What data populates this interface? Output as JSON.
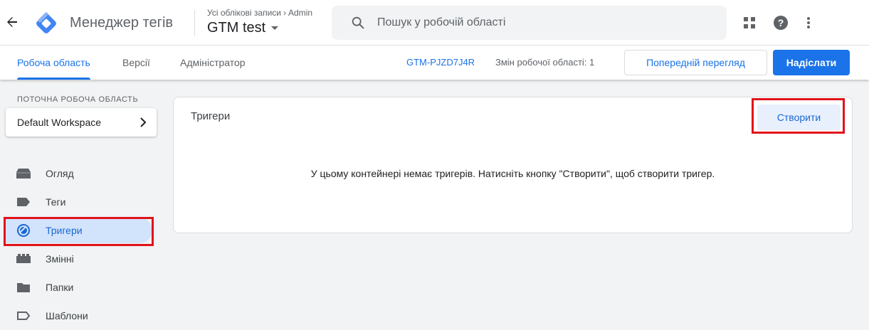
{
  "header": {
    "product_name": "Менеджер тегів",
    "breadcrumb_accounts": "Усі облікові записи",
    "breadcrumb_account": "Admin",
    "container_name": "GTM test",
    "search_placeholder": "Пошук у робочій області"
  },
  "subnav": {
    "tabs": [
      {
        "label": "Робоча область",
        "active": true
      },
      {
        "label": "Версії",
        "active": false
      },
      {
        "label": "Адміністратор",
        "active": false
      }
    ],
    "container_id": "GTM-PJZD7J4R",
    "workspace_changes": "Змін робочої області: 1",
    "preview_label": "Попередній перегляд",
    "submit_label": "Надіслати"
  },
  "sidebar": {
    "workspace_label": "ПОТОЧНА РОБОЧА ОБЛАСТЬ",
    "workspace_name": "Default Workspace",
    "items": [
      {
        "label": "Огляд",
        "icon": "overview-icon"
      },
      {
        "label": "Теги",
        "icon": "tag-icon"
      },
      {
        "label": "Тригери",
        "icon": "trigger-icon",
        "active": true
      },
      {
        "label": "Змінні",
        "icon": "variables-icon"
      },
      {
        "label": "Папки",
        "icon": "folder-icon"
      },
      {
        "label": "Шаблони",
        "icon": "template-icon"
      }
    ]
  },
  "main": {
    "title": "Тригери",
    "create_label": "Створити",
    "empty_message": "У цьому контейнері немає тригерів. Натисніть кнопку \"Створити\", щоб створити тригер."
  },
  "colors": {
    "accent": "#1a73e8",
    "highlight": "#e0121c",
    "active_nav_bg": "#d2e3fc"
  }
}
